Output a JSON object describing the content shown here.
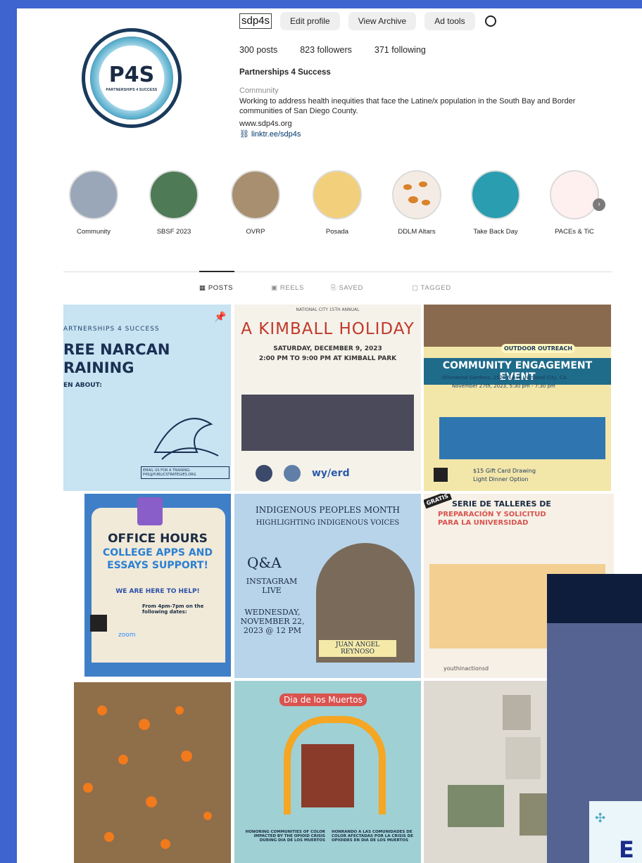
{
  "profile": {
    "username": "sdp4s",
    "buttons": [
      "Edit profile",
      "View Archive",
      "Ad tools"
    ],
    "posts": "300 posts",
    "followers": "823 followers",
    "following": "371 following",
    "full_name": "Partnerships 4 Success",
    "category": "Community",
    "bio": "Working to address health inequities that face the Latine/x population in the South Bay and Border communities of San Diego County.",
    "website": "www.sdp4s.org",
    "linktree": "linktr.ee/sdp4s",
    "avatar_text": "P4S",
    "avatar_subtext": "PARTNERSHIPS 4 SUCCESS"
  },
  "highlights": [
    {
      "label": "Community",
      "color": "#9aa7b8"
    },
    {
      "label": "SBSF 2023",
      "color": "#4e7a55"
    },
    {
      "label": "OVRP",
      "color": "#a78f70"
    },
    {
      "label": "Posada",
      "color": "#f2cf7a"
    },
    {
      "label": "DDLM Altars",
      "color": "#f4ece4"
    },
    {
      "label": "Take Back Day",
      "color": "#2a9db0"
    },
    {
      "label": "PACEs & TiC",
      "color": "#fdf0ee"
    }
  ],
  "tabs": [
    "POSTS",
    "REELS",
    "SAVED",
    "TAGGED"
  ],
  "posts": {
    "narcan": {
      "line1": "ARTNERSHIPS 4 SUCCESS",
      "line2": "REE NARCAN",
      "line3": "RAINING",
      "line4": "EN ABOUT:",
      "email": "EMAIL US FOR A TRAINING: P4S@PUBLICSTRATEGIES.ORG"
    },
    "kimball": {
      "kicker": "NATIONAL CITY 15TH ANNUAL",
      "title": "A KIMBALL HOLIDAY",
      "date": "SATURDAY, DECEMBER 9, 2023",
      "time": "2:00 PM TO 9:00 PM AT KIMBALL PARK"
    },
    "outdoor": {
      "badge": "OUTDOOR OUTREACH",
      "title": "COMMUNITY ENGAGEMENT EVENT",
      "line": "Olivewood Gardens, 2525 N Ave. National City, CA",
      "date": "November 27th, 2023, 5:30 pm - 7:30 pm",
      "gift": "$15 Gift Card Drawing",
      "dinner": "Light Dinner Option"
    },
    "office": {
      "title": "OFFICE HOURS",
      "sub1": "COLLEGE APPS AND",
      "sub2": "ESSAYS SUPPORT!",
      "help": "WE ARE HERE TO HELP!",
      "time": "From 4pm-7pm on the following dates:",
      "zoom": "zoom"
    },
    "indigenous": {
      "title": "INDIGENOUS PEOPLES MONTH",
      "sub": "HIGHLIGHTING INDIGENOUS VOICES",
      "qa": "Q&A",
      "live": "INSTAGRAM LIVE",
      "when": "WEDNESDAY, NOVEMBER 22, 2023 @ 12 PM",
      "name": "JUAN ANGEL REYNOSO"
    },
    "serie": {
      "gratis": "GRATIS",
      "title": "SERIE DE TALLERES DE",
      "sub": "PREPARACIÓN Y SOLICITUD PARA LA UNIVERSIDAD",
      "handle": "youthinactionsd"
    },
    "muertos": {
      "title": "Dia de los Muertos",
      "left": "HONORING COMMUNITIES OF COLOR IMPACTED BY THE OPIOID CRISIS DURING DIA DE LOS MUERTOS",
      "right": "HONRANDO A LAS COMUNIDADES DE COLOR AFECTADAS POR LA CRISIS DE OPIOIDES EN DIA DE LOS MUERTOS"
    }
  },
  "colors": {
    "accent_blue": "#3a5fcd",
    "link": "#00376b",
    "muted": "#8e8e8e"
  }
}
